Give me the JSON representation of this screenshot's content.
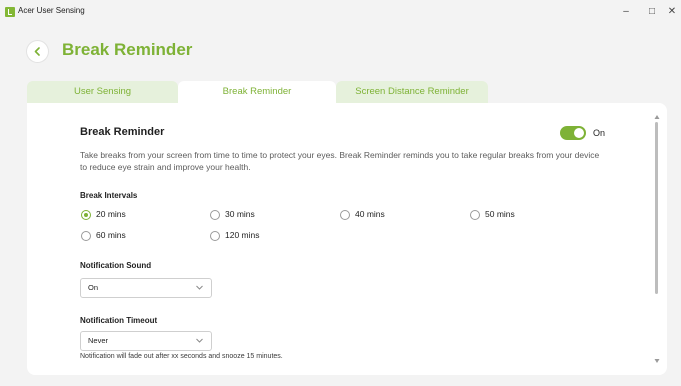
{
  "window": {
    "title": "Acer User Sensing",
    "minimize_glyph": "–",
    "maximize_glyph": "□",
    "close_glyph": "✕",
    "accent_color": "#7eb236",
    "logo_icon": "acer-user-sensing-logo"
  },
  "header": {
    "back_icon": "chevron-left-icon",
    "title": "Break Reminder"
  },
  "tabs": [
    {
      "label": "User Sensing",
      "active": false
    },
    {
      "label": "Break Reminder",
      "active": true
    },
    {
      "label": "Screen Distance Reminder",
      "active": false
    }
  ],
  "break_reminder": {
    "title": "Break Reminder",
    "toggle_state": "On",
    "description": "Take breaks from your screen from time to time to protect your eyes. Break Reminder reminds you to take regular breaks from your device to reduce eye strain and improve your health.",
    "intervals_label": "Break Intervals",
    "intervals": [
      {
        "label": "20 mins",
        "selected": true
      },
      {
        "label": "30 mins",
        "selected": false
      },
      {
        "label": "40 mins",
        "selected": false
      },
      {
        "label": "50 mins",
        "selected": false
      },
      {
        "label": "60 mins",
        "selected": false
      },
      {
        "label": "120 mins",
        "selected": false
      }
    ],
    "sound_label": "Notification Sound",
    "sound_value": "On",
    "timeout_label": "Notification Timeout",
    "timeout_value": "Never",
    "timeout_note": "Notification will fade out after xx seconds and snooze 15 minutes."
  }
}
